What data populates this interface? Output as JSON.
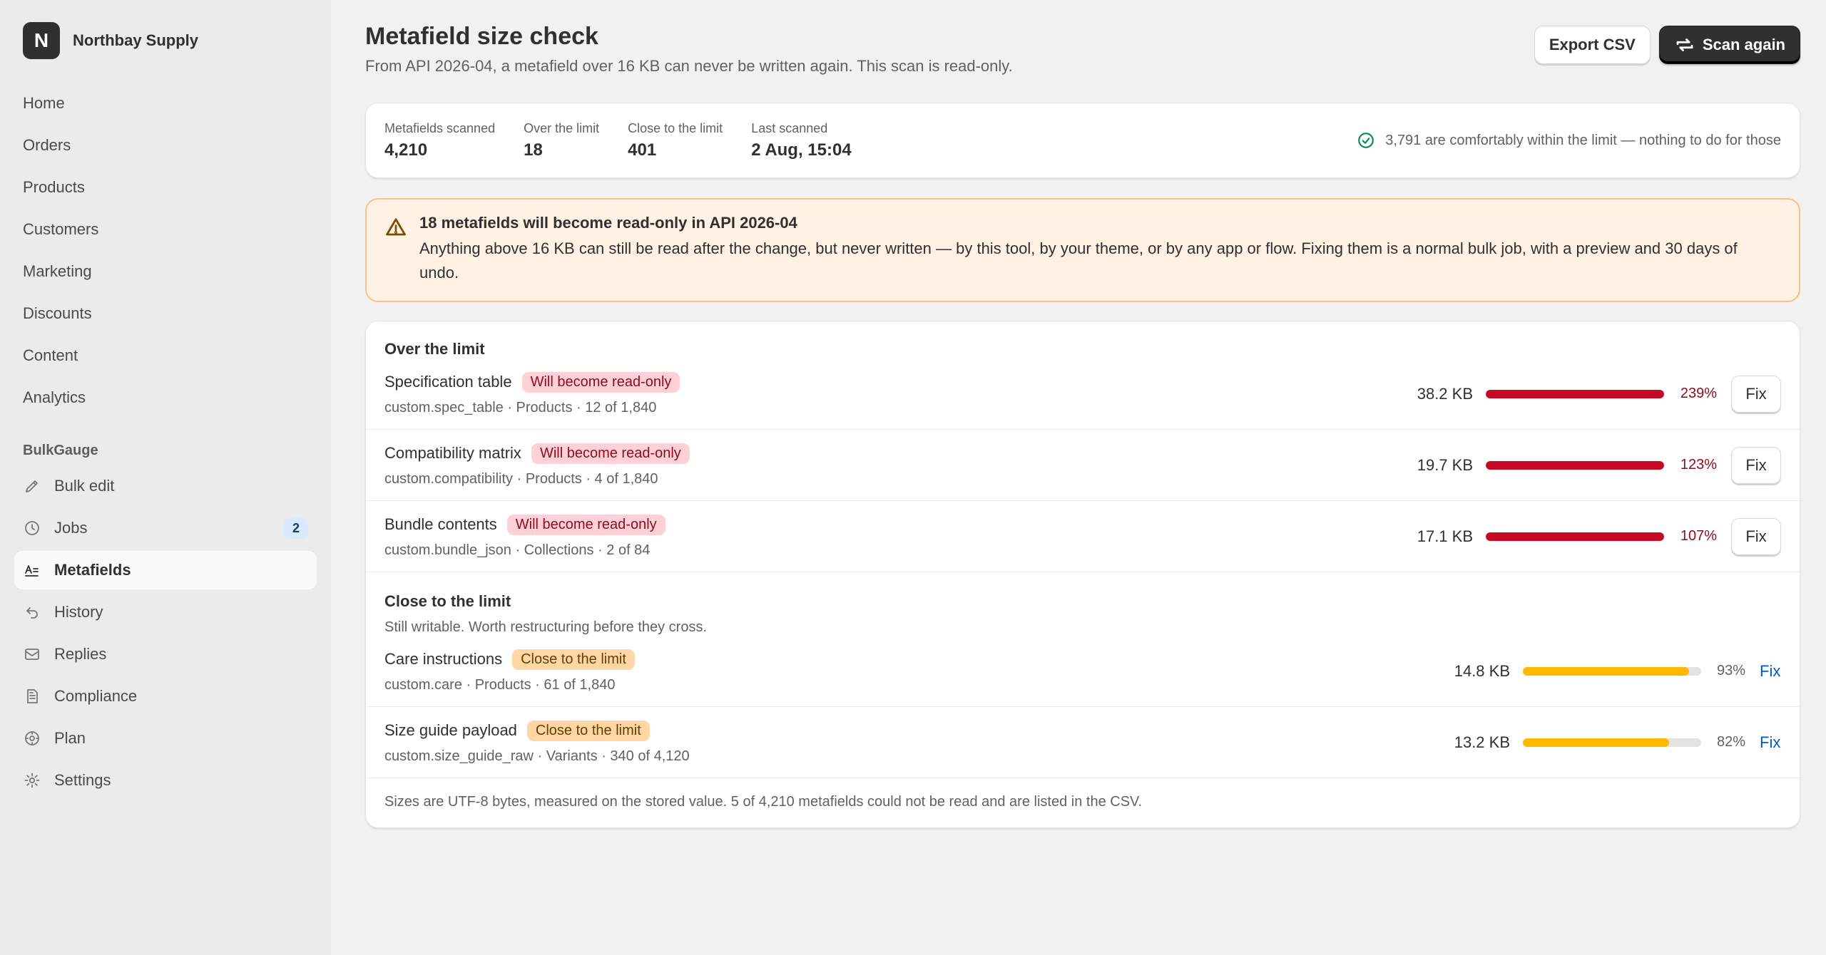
{
  "sidebar": {
    "store_initial": "N",
    "store_name": "Northbay Supply",
    "nav": [
      {
        "label": "Home"
      },
      {
        "label": "Orders"
      },
      {
        "label": "Products"
      },
      {
        "label": "Customers"
      },
      {
        "label": "Marketing"
      },
      {
        "label": "Discounts"
      },
      {
        "label": "Content"
      },
      {
        "label": "Analytics"
      }
    ],
    "app_section": "BulkGauge",
    "app_items": [
      {
        "label": "Bulk edit",
        "icon": "pencil-icon"
      },
      {
        "label": "Jobs",
        "icon": "clock-icon",
        "badge": "2"
      },
      {
        "label": "Metafields",
        "icon": "metafields-icon",
        "active": true
      },
      {
        "label": "History",
        "icon": "undo-icon"
      },
      {
        "label": "Replies",
        "icon": "mail-icon"
      },
      {
        "label": "Compliance",
        "icon": "document-icon"
      },
      {
        "label": "Plan",
        "icon": "plan-icon"
      },
      {
        "label": "Settings",
        "icon": "gear-icon"
      }
    ]
  },
  "header": {
    "title": "Metafield size check",
    "subtitle": "From API 2026-04, a metafield over 16 KB can never be written again. This scan is read-only.",
    "export_label": "Export CSV",
    "scan_label": "Scan again"
  },
  "stats": {
    "items": [
      {
        "label": "Metafields scanned",
        "value": "4,210"
      },
      {
        "label": "Over the limit",
        "value": "18"
      },
      {
        "label": "Close to the limit",
        "value": "401"
      },
      {
        "label": "Last scanned",
        "value": "2 Aug, 15:04"
      }
    ],
    "note": "3,791 are comfortably within the limit — nothing to do for those"
  },
  "banner": {
    "title": "18 metafields will become read-only in API 2026-04",
    "body": "Anything above 16 KB can still be read after the change, but never written — by this tool, by your theme, or by any app or flow. Fixing them is a normal bulk job, with a preview and 30 days of undo."
  },
  "over": {
    "title": "Over the limit",
    "rows": [
      {
        "name": "Specification table",
        "tag": "Will become read-only",
        "meta": "custom.spec_table · Products · 12 of 1,840",
        "size": "38.2 KB",
        "pct": "239%",
        "fill": 1.0,
        "fix": "Fix"
      },
      {
        "name": "Compatibility matrix",
        "tag": "Will become read-only",
        "meta": "custom.compatibility · Products · 4 of 1,840",
        "size": "19.7 KB",
        "pct": "123%",
        "fill": 1.0,
        "fix": "Fix"
      },
      {
        "name": "Bundle contents",
        "tag": "Will become read-only",
        "meta": "custom.bundle_json · Collections · 2 of 84",
        "size": "17.1 KB",
        "pct": "107%",
        "fill": 1.0,
        "fix": "Fix"
      }
    ]
  },
  "close": {
    "title": "Close to the limit",
    "desc": "Still writable. Worth restructuring before they cross.",
    "rows": [
      {
        "name": "Care instructions",
        "tag": "Close to the limit",
        "meta": "custom.care · Products · 61 of 1,840",
        "size": "14.8 KB",
        "pct": "93%",
        "fill": 0.93,
        "fix": "Fix"
      },
      {
        "name": "Size guide payload",
        "tag": "Close to the limit",
        "meta": "custom.size_guide_raw · Variants · 340 of 4,120",
        "size": "13.2 KB",
        "pct": "82%",
        "fill": 0.82,
        "fix": "Fix"
      }
    ]
  },
  "footnote": "Sizes are UTF-8 bytes, measured on the stored value. 5 of 4,210 metafields could not be read and are listed in the CSV.",
  "colors": {
    "over_bar": "#c70a24",
    "close_bar": "#ffb800",
    "link": "#005bd3"
  }
}
